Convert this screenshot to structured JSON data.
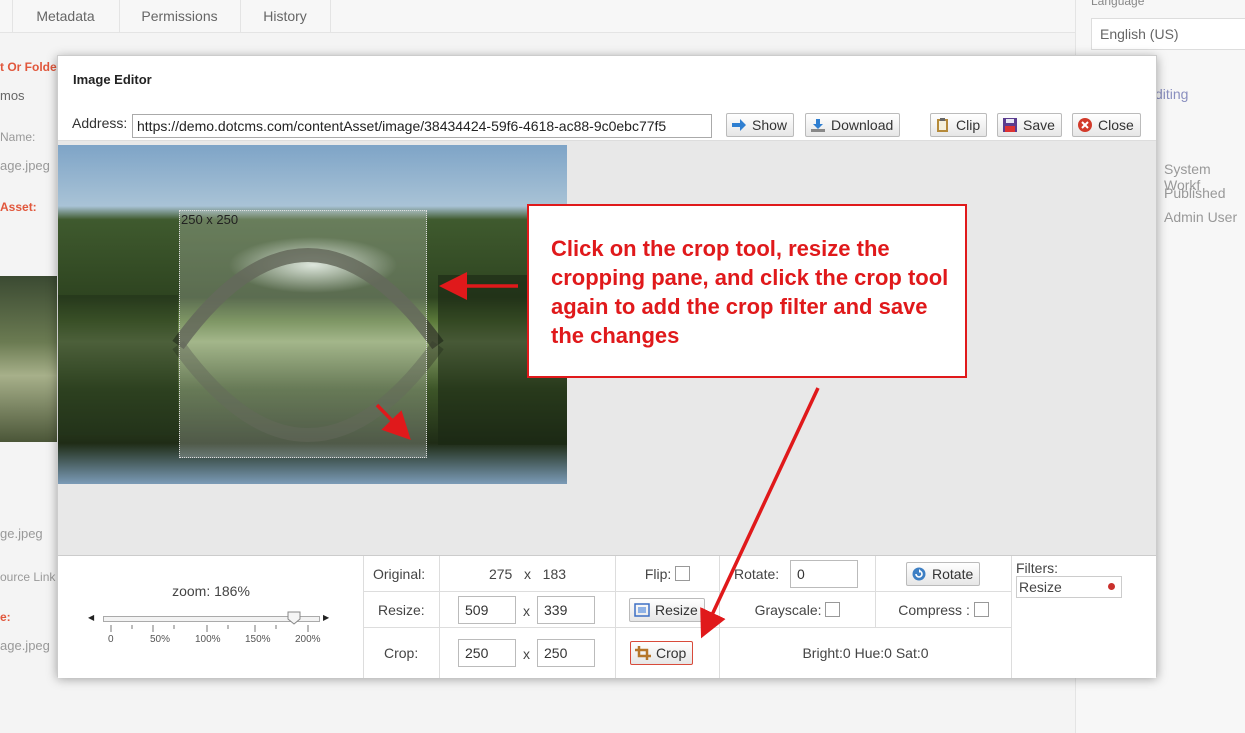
{
  "background": {
    "tabs": [
      "Metadata",
      "Permissions",
      "History"
    ],
    "left_labels": [
      "t Or Folder:",
      "Name:",
      "Asset:",
      "ource Link",
      "e:"
    ],
    "left_values": [
      "mos",
      "age.jpeg",
      "ge.jpeg",
      "age.jpeg"
    ],
    "right": {
      "language_label": "Language",
      "language_value": "English (US)",
      "editing": "diting",
      "workflow": "System Workf",
      "status": "Published",
      "user": "Admin User"
    }
  },
  "dialog": {
    "title": "Image Editor",
    "address_label": "Address:",
    "address_value": "https://demo.dotcms.com/contentAsset/image/38434424-59f6-4618-ac88-9c0ebc77f5",
    "buttons": {
      "show": "Show",
      "download": "Download",
      "clip": "Clip",
      "save": "Save",
      "close": "Close"
    },
    "crop_overlay_label": "250 x 250"
  },
  "callout": {
    "text": "Click on the crop tool, resize the cropping pane, and click the crop tool again to add the crop filter and save the changes"
  },
  "panel": {
    "zoom_label": "zoom: 186%",
    "zoom_value_percent": 186,
    "zoom_ticks": [
      "0",
      "50%",
      "100%",
      "150%",
      "200%"
    ],
    "original_label": "Original:",
    "original_w": "275",
    "original_h": "183",
    "x": "x",
    "resize_label": "Resize:",
    "resize_w": "509",
    "resize_h": "339",
    "crop_label": "Crop:",
    "crop_w": "250",
    "crop_h": "250",
    "flip_label": "Flip:",
    "resize_button": "Resize",
    "crop_button": "Crop",
    "rotate_label": "Rotate:",
    "rotate_value": "0",
    "rotate_button": "Rotate",
    "grayscale_label": "Grayscale:",
    "compress_label": "Compress :",
    "bright_hue_sat": "Bright:0  Hue:0  Sat:0",
    "filters_label": "Filters:",
    "filters_items": [
      "Resize"
    ]
  },
  "colors": {
    "callout_red": "#e0191b",
    "label_orange": "#e1573c"
  }
}
